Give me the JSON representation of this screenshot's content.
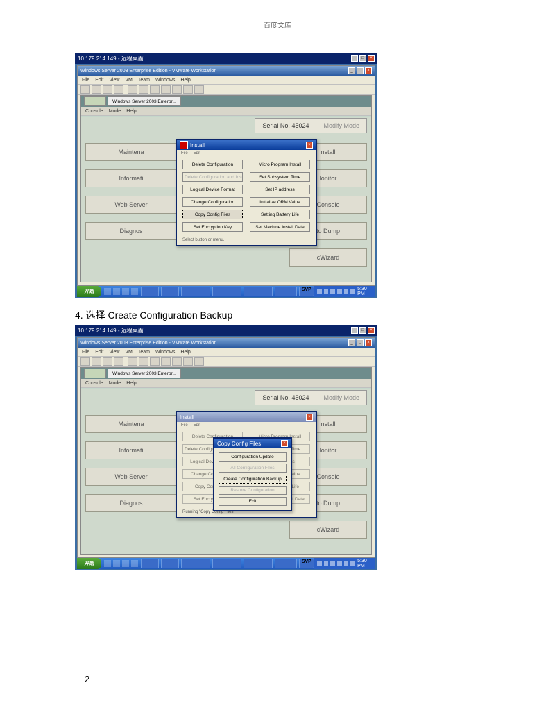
{
  "header": "百度文库",
  "step_text": "4. 选择  Create Configuration Backup",
  "page_number": "2",
  "outer_title": "10.179.214.149 - 远程桌面",
  "app_title": "Windows Server 2003 Enterprise Edition - VMware Workstation",
  "vm_menu": {
    "file": "File",
    "edit": "Edit",
    "view": "View",
    "vm": "VM",
    "team": "Team",
    "windows": "Windows",
    "help": "Help"
  },
  "inner_menu": {
    "console": "Console",
    "mode": "Mode",
    "help": "Help"
  },
  "tab_label": "Windows Server 2003 Enterpr...",
  "serial_label": "Serial No. 45024",
  "modify_mode": "Modify Mode",
  "left_rows": {
    "r1": "Maintena",
    "r2": "Informati",
    "r3": "Web Server",
    "r4": "Diagnos"
  },
  "right_rows": {
    "r1": "nstall",
    "r2": "lonitor",
    "r3": "Console",
    "r4": "to Dump",
    "r5": "cWizard"
  },
  "install_dialog": {
    "title": "Install",
    "file": "File",
    "edit": "Edit",
    "footer": "Select button or menu.",
    "btns": [
      "Delete Configuration",
      "Micro Program Install",
      "Delete Configuration and Install",
      "Set Subsystem Time",
      "Logical Device Format",
      "Set IP address",
      "Change Configuration",
      "Initialize ORM Value",
      "Copy Config Files",
      "Setting Battery Life",
      "Set Encryption Key",
      "Set Machine Install Date"
    ]
  },
  "copy_dialog": {
    "title": "Copy Config Files",
    "btns": [
      "Configuration Update",
      "All Configuration Files",
      "Create Configuration Backup",
      "Restore Configuration",
      "Exit"
    ]
  },
  "running_text": "Running \"Copy Config Files\"",
  "start": "开始",
  "task_badge": "SVP",
  "tray_time": "5:30 PM"
}
